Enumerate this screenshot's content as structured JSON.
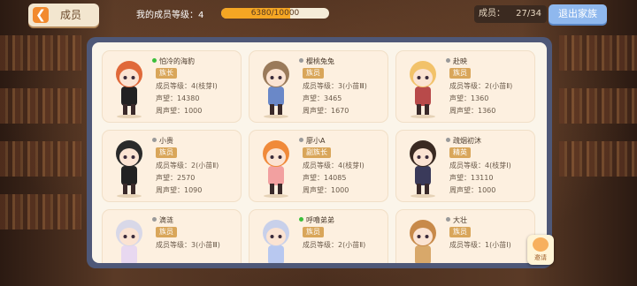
{
  "header": {
    "back_icon": "chevron-left-icon",
    "title": "成员",
    "my_level_label": "我的成员等级：4",
    "xp": {
      "current": 6380,
      "max": 10000,
      "text": "6380/10000"
    },
    "member_count_label": "成员：",
    "member_count_value": "27/34",
    "exit_button": "退出家族"
  },
  "colors": {
    "accent": "#f5a623",
    "panel_frame": "#4e5878",
    "card_bg": "#fdf0e0",
    "online": "#3bbf3b",
    "offline": "#9a9a9a"
  },
  "members": [
    {
      "name": "怕冷的海豹",
      "online": true,
      "role": "族长",
      "level": "成员等级：4(枝芽Ⅰ)",
      "rep": "声望：14380",
      "week": "周声望：1000"
    },
    {
      "name": "樱桃兔兔",
      "online": false,
      "role": "族员",
      "level": "成员等级：3(小苗Ⅲ)",
      "rep": "声望：3465",
      "week": "周声望：1670"
    },
    {
      "name": "赴映",
      "online": false,
      "role": "族员",
      "level": "成员等级：2(小苗Ⅱ)",
      "rep": "声望：1360",
      "week": "周声望：1360"
    },
    {
      "name": "小贵",
      "online": false,
      "role": "族员",
      "level": "成员等级：2(小苗Ⅱ)",
      "rep": "声望：2570",
      "week": "周声望：1090"
    },
    {
      "name": "廖小A",
      "online": false,
      "role": "副族长",
      "level": "成员等级：4(枝芽Ⅰ)",
      "rep": "声望：14085",
      "week": "周声望：1000"
    },
    {
      "name": "疏烟初沐",
      "online": false,
      "role": "精英",
      "level": "成员等级：4(枝芽Ⅰ)",
      "rep": "声望：13110",
      "week": "周声望：1000"
    },
    {
      "name": "滴涟",
      "online": false,
      "role": "族员",
      "level": "成员等级：3(小苗Ⅲ)",
      "rep": "",
      "week": ""
    },
    {
      "name": "呼噜弟弟",
      "online": true,
      "role": "族员",
      "level": "成员等级：2(小苗Ⅱ)",
      "rep": "",
      "week": ""
    },
    {
      "name": "大壮",
      "online": false,
      "role": "族员",
      "level": "成员等级：1(小苗Ⅰ)",
      "rep": "",
      "week": ""
    }
  ],
  "invite": {
    "icon": "cat-face-icon",
    "label": "邀请"
  }
}
